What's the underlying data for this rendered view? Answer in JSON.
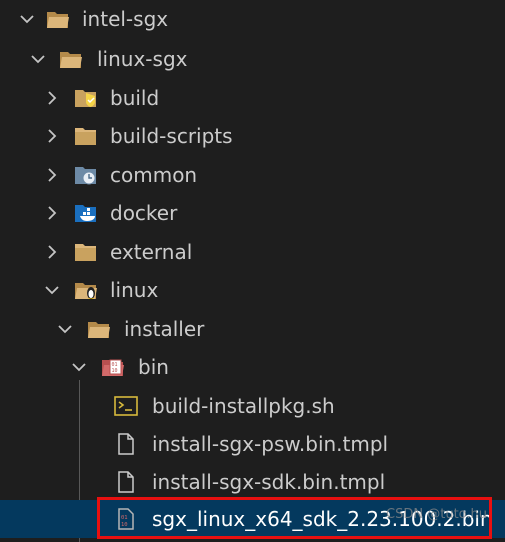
{
  "tree": {
    "items": [
      {
        "label": "intel-sgx",
        "expanded": true,
        "icon": "folder-open-icon"
      },
      {
        "label": "linux-sgx",
        "expanded": true,
        "icon": "folder-open-icon"
      },
      {
        "label": "build",
        "expanded": false,
        "icon": "folder-build-icon"
      },
      {
        "label": "build-scripts",
        "expanded": false,
        "icon": "folder-icon"
      },
      {
        "label": "common",
        "expanded": false,
        "icon": "folder-common-icon"
      },
      {
        "label": "docker",
        "expanded": false,
        "icon": "folder-docker-icon"
      },
      {
        "label": "external",
        "expanded": false,
        "icon": "folder-icon"
      },
      {
        "label": "linux",
        "expanded": true,
        "icon": "folder-linux-icon"
      },
      {
        "label": "installer",
        "expanded": true,
        "icon": "folder-open-icon"
      },
      {
        "label": "bin",
        "expanded": true,
        "icon": "folder-bin-icon"
      },
      {
        "label": "build-installpkg.sh",
        "icon": "shell-script-icon"
      },
      {
        "label": "install-sgx-psw.bin.tmpl",
        "icon": "file-icon"
      },
      {
        "label": "install-sgx-sdk.bin.tmpl",
        "icon": "file-icon"
      },
      {
        "label": "sgx_linux_x64_sdk_2.23.100.2.bin",
        "icon": "binary-file-icon",
        "selected": true
      }
    ]
  },
  "watermark": "CSDN @tuto.hu",
  "colors": {
    "background": "#1e1e1e",
    "selected_row": "#04395e",
    "highlight_border": "#e81010",
    "folder": "#d8b06b"
  }
}
